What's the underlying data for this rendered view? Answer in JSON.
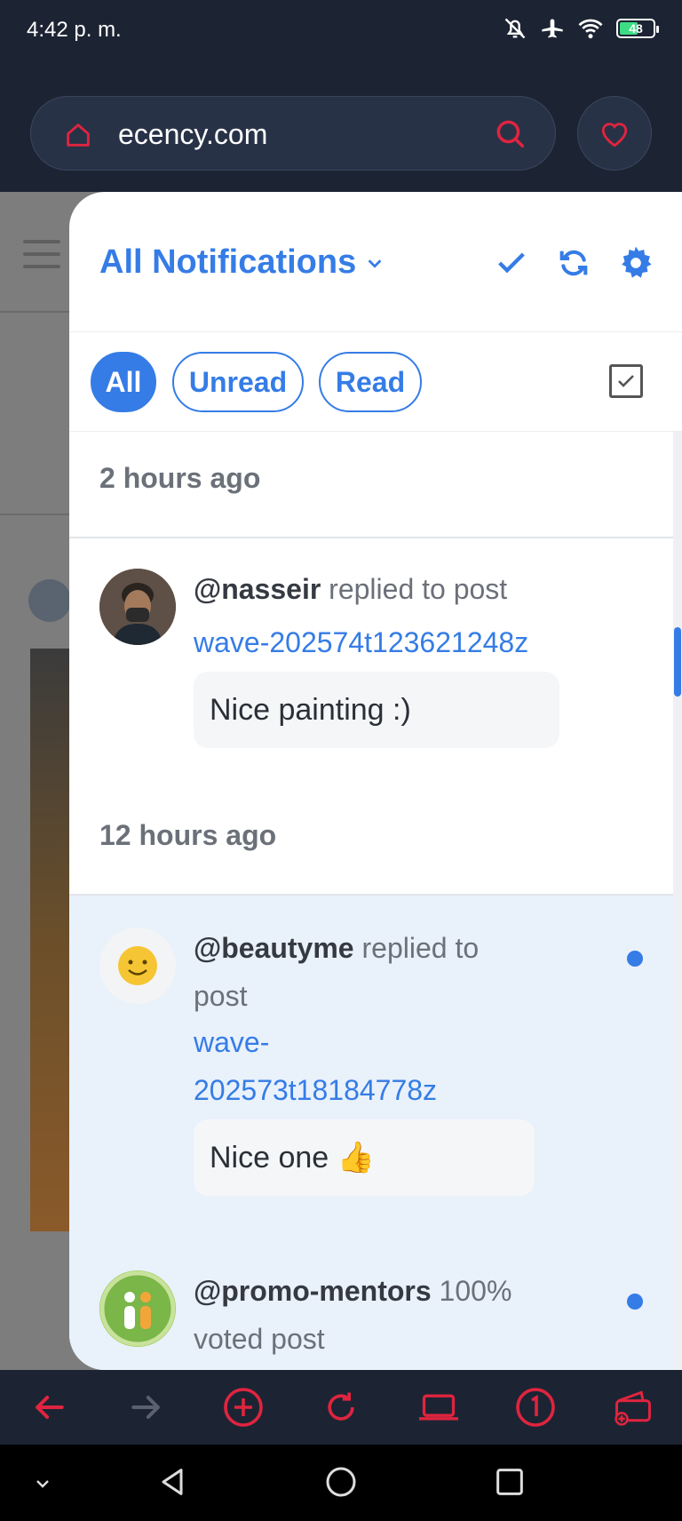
{
  "status": {
    "time": "4:42 p. m.",
    "battery": "48"
  },
  "browser": {
    "url": "ecency.com"
  },
  "panel": {
    "title": "All Notifications",
    "filters": [
      "All",
      "Unread",
      "Read"
    ]
  },
  "groups": [
    {
      "label": "2 hours ago"
    },
    {
      "label": "12 hours ago"
    }
  ],
  "notifications": [
    {
      "user": "@nasseir",
      "action": "replied to post",
      "link": "wave-202574t123621248z",
      "quote": "Nice painting :)",
      "unread": false
    },
    {
      "user": "@beautyme",
      "action_line1": "replied to",
      "action_line2": "post",
      "link_line1": "wave-",
      "link_line2": "202573t18184778z",
      "quote": "Nice one 👍",
      "unread": true
    },
    {
      "user": "@promo-mentors",
      "action_line1": "100%",
      "action_line2": "voted post",
      "unread": true
    }
  ],
  "colors": {
    "accent": "#357ce6",
    "toolbar_icon": "#e0243f",
    "unread_bg": "#e9f1fb"
  }
}
